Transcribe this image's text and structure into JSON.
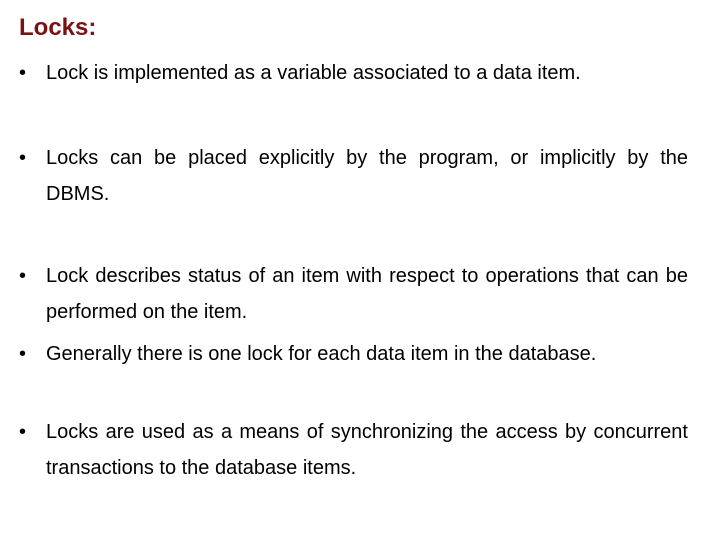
{
  "slide": {
    "title": "Locks:",
    "bullet_glyph": "•",
    "bullets": [
      "Lock is implemented as a variable associated to a data item.",
      "Locks can be placed explicitly by the program, or implicitly by the DBMS.",
      "Lock describes status of an item with respect to operations that can be performed on the item.",
      "Generally there is one lock for each data item in the database.",
      "Locks are used as a means of synchronizing the access by concurrent transactions to the database items."
    ]
  },
  "colors": {
    "title": "#7b1113",
    "text": "#000000",
    "background": "#ffffff"
  }
}
